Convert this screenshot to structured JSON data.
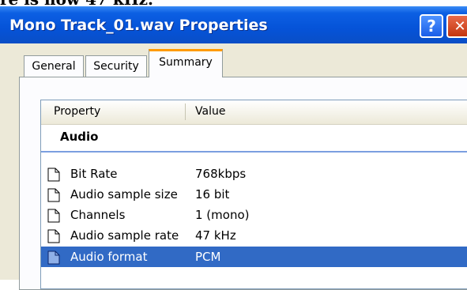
{
  "top_caption": "re is now 47 kHz.",
  "window": {
    "title": "Mono Track_01.wav Properties",
    "help_label": "?",
    "close_label": "✕"
  },
  "tabs": [
    {
      "label": "General",
      "selected": false
    },
    {
      "label": "Security",
      "selected": false
    },
    {
      "label": "Summary",
      "selected": true
    }
  ],
  "table": {
    "columns": [
      "Property",
      "Value"
    ],
    "group": "Audio",
    "rows": [
      {
        "property": "Bit Rate",
        "value": "768kbps",
        "icon": "document-icon"
      },
      {
        "property": "Audio sample size",
        "value": "16 bit",
        "icon": "document-icon"
      },
      {
        "property": "Channels",
        "value": "1 (mono)",
        "icon": "document-icon"
      },
      {
        "property": "Audio sample rate",
        "value": "47 kHz",
        "icon": "document-icon"
      },
      {
        "property": "Audio format",
        "value": "PCM",
        "icon": "document-icon",
        "selected": true
      }
    ]
  },
  "colors": {
    "titlebar": "#0553d8",
    "selection": "#316ac5",
    "tab_highlight": "#ff9b00",
    "dialog_bg": "#ece9d8"
  }
}
